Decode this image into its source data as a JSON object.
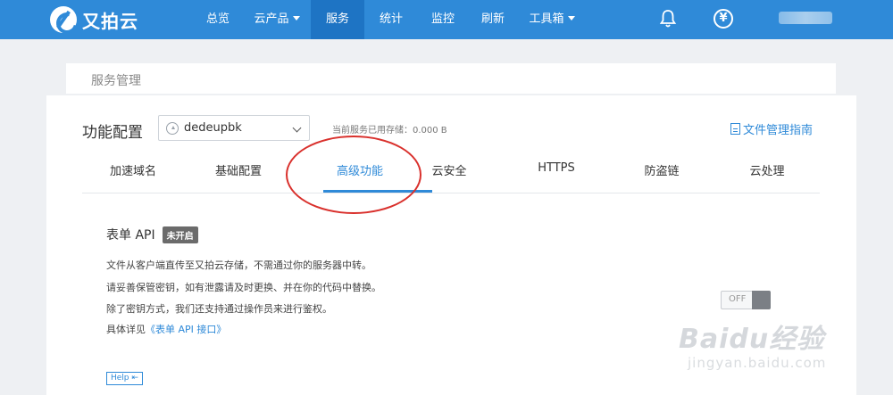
{
  "app": {
    "brand": "又拍云"
  },
  "topnav": {
    "items": [
      {
        "label": "总览"
      },
      {
        "label": "云产品"
      },
      {
        "label": "服务"
      },
      {
        "label": "统计"
      },
      {
        "label": "监控"
      },
      {
        "label": "刷新"
      },
      {
        "label": "工具箱"
      }
    ],
    "yen_symbol": "¥"
  },
  "breadcrumb": {
    "title": "服务管理"
  },
  "config": {
    "title": "功能配置",
    "service_select_value": "dedeupbk",
    "storage_text": "当前服务已用存储：0.000 B",
    "guide_link": "文件管理指南"
  },
  "tabs": [
    {
      "label": "加速域名"
    },
    {
      "label": "基础配置"
    },
    {
      "label": "高级功能"
    },
    {
      "label": "云安全"
    },
    {
      "label": "HTTPS"
    },
    {
      "label": "防盗链"
    },
    {
      "label": "云处理"
    }
  ],
  "form_api": {
    "title": "表单 API",
    "badge": "未开启",
    "lines": [
      "文件从客户端直传至又拍云存储，不需通过你的服务器中转。",
      "请妥善保管密钥，如有泄露请及时更换、并在你的代码中替换。",
      "除了密钥方式，我们还支持通过操作员来进行鉴权。"
    ],
    "detail_prefix": "具体详见",
    "detail_link": "《表单 API 接口》",
    "toggle_label": "OFF",
    "help_label": "Help ⇤"
  },
  "watermark": {
    "main": "Baidu经验",
    "sub": "jingyan.baidu.com"
  },
  "colors": {
    "brand": "#2f8ad8",
    "nav_active": "#1e74c4",
    "highlight_ring": "#d9302c",
    "badge": "#6b6b6b"
  }
}
